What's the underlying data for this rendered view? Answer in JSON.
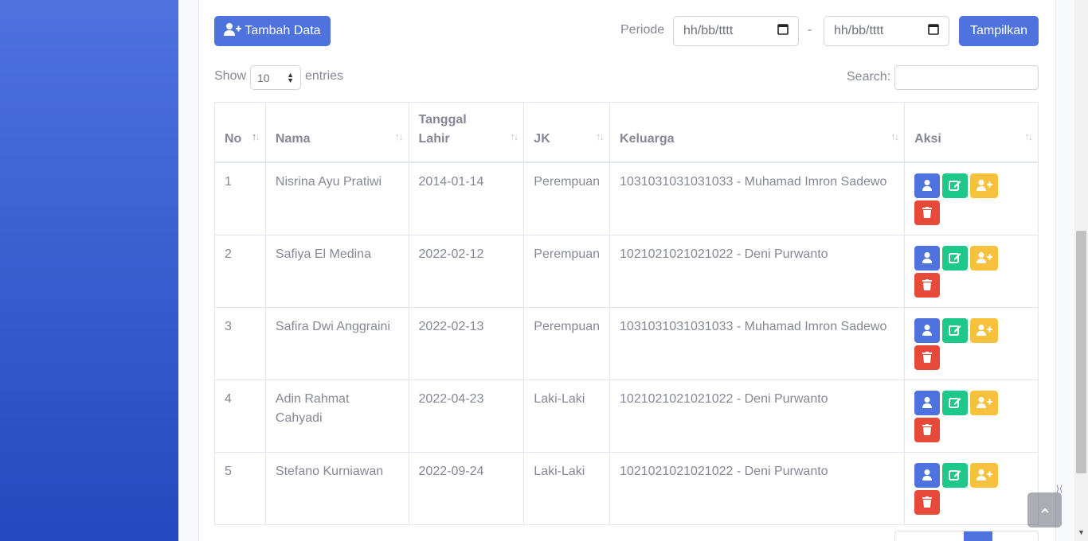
{
  "toolbar": {
    "add_label": "Tambah Data",
    "periode_label": "Periode",
    "date_from_placeholder": "hh/bb/tttt",
    "date_separator": "-",
    "date_to_placeholder": "hh/bb/tttt",
    "show_button": "Tampilkan"
  },
  "table_controls": {
    "show_label": "Show",
    "entries_value": "10",
    "entries_label": "entries",
    "search_label": "Search:"
  },
  "columns": {
    "no": "No",
    "nama": "Nama",
    "tanggal_lahir": "Tanggal Lahir",
    "jk": "JK",
    "keluarga": "Keluarga",
    "aksi": "Aksi"
  },
  "rows": [
    {
      "no": "1",
      "nama": "Nisrina Ayu Pratiwi",
      "tanggal_lahir": "2014-01-14",
      "jk": "Perempuan",
      "keluarga": "1031031031031033 - Muhamad Imron Sadewo"
    },
    {
      "no": "2",
      "nama": "Safiya El Medina",
      "tanggal_lahir": "2022-02-12",
      "jk": "Perempuan",
      "keluarga": "1021021021021022 - Deni Purwanto"
    },
    {
      "no": "3",
      "nama": "Safira Dwi Anggraini",
      "tanggal_lahir": "2022-02-13",
      "jk": "Perempuan",
      "keluarga": "1031031031031033 - Muhamad Imron Sadewo"
    },
    {
      "no": "4",
      "nama": "Adin Rahmat Cahyadi",
      "tanggal_lahir": "2022-04-23",
      "jk": "Laki-Laki",
      "keluarga": "1021021021021022 - Deni Purwanto"
    },
    {
      "no": "5",
      "nama": "Stefano Kurniawan",
      "tanggal_lahir": "2022-09-24",
      "jk": "Laki-Laki",
      "keluarga": "1021021021021022 - Deni Purwanto"
    }
  ],
  "icons": {
    "add": "user-plus-icon",
    "calendar": "calendar-icon",
    "detail": "user-icon",
    "edit": "edit-icon",
    "add_family": "user-plus-icon",
    "delete": "trash-icon",
    "scroll_top": "chevron-up-icon"
  },
  "colors": {
    "primary": "#4e73df",
    "success": "#1cc88a",
    "warning": "#f6c23e",
    "danger": "#e74a3b",
    "text": "#858796"
  }
}
